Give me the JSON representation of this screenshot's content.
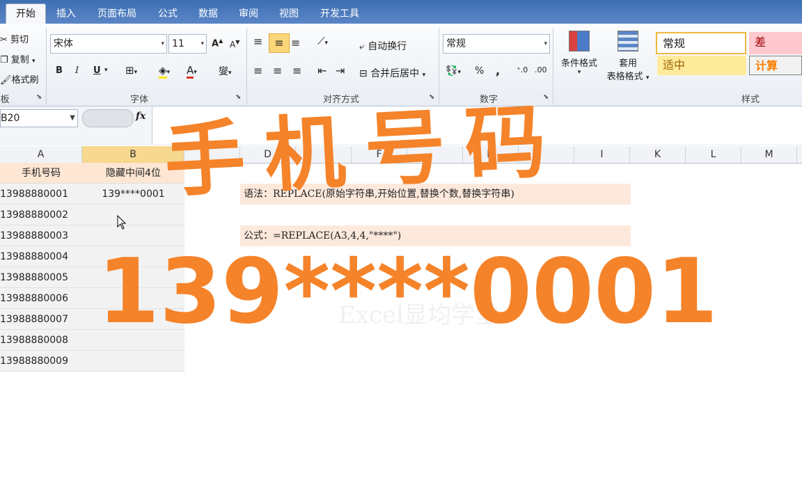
{
  "tabs": [
    "开始",
    "插入",
    "页面布局",
    "公式",
    "数据",
    "审阅",
    "视图",
    "开发工具"
  ],
  "clipboard": {
    "cut": "剪切",
    "copy": "复制",
    "format_painter": "格式刷",
    "label": "板"
  },
  "font": {
    "name": "宋体",
    "size": "11",
    "bold": "B",
    "italic": "I",
    "underline": "U",
    "label": "字体"
  },
  "alignment": {
    "wrap": "自动换行",
    "merge": "合并后居中",
    "label": "对齐方式"
  },
  "number": {
    "format": "常规",
    "percent": "%",
    "comma": ",",
    "label": "数字"
  },
  "styles": {
    "conditional": "条件格式",
    "table_line1": "套用",
    "table_line2": "表格格式",
    "normal": "常规",
    "bad": "差",
    "neutral": "适中",
    "calc": "计算",
    "label": "样式"
  },
  "formula_bar": {
    "name_box": "B20",
    "fx": "fx"
  },
  "columns": [
    "A",
    "B",
    "",
    "D",
    "",
    "F",
    "",
    "H",
    "",
    "I",
    "K",
    "L",
    "M"
  ],
  "table": {
    "header": [
      "手机号码",
      "隐藏中间4位"
    ],
    "rows": [
      [
        "13988880001",
        "139****0001"
      ],
      [
        "13988880002",
        ""
      ],
      [
        "13988880003",
        ""
      ],
      [
        "13988880004",
        ""
      ],
      [
        "13988880005",
        ""
      ],
      [
        "13988880006",
        ""
      ],
      [
        "13988880007",
        ""
      ],
      [
        "13988880008",
        ""
      ],
      [
        "13988880009",
        ""
      ]
    ]
  },
  "notes": {
    "syntax": "语法：REPLACE(原始字符串,开始位置,替换个数,替换字符串)",
    "formula": "公式：=REPLACE(A3,4,4,\"****\")"
  },
  "overlay": {
    "title": "手机号码",
    "example": "139****0001"
  },
  "watermark": "Excel显均学堂",
  "colors": {
    "accent": "#f5832a",
    "tab_bar": "#3d6fb4"
  }
}
